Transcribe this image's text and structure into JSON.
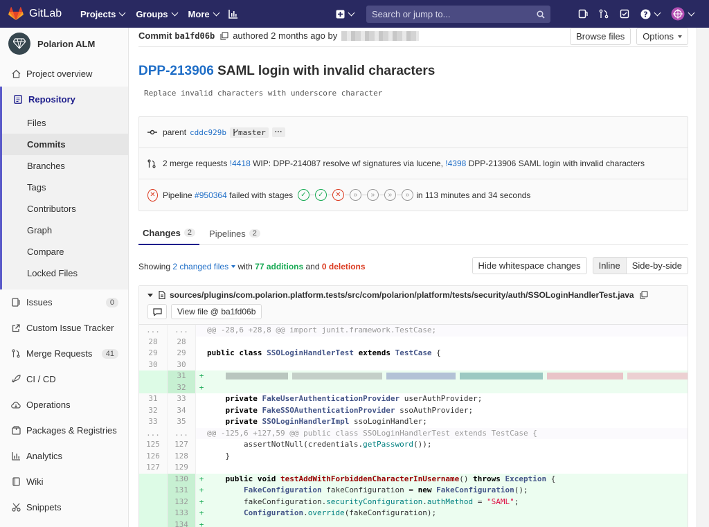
{
  "topbar": {
    "brand": "GitLab",
    "nav": [
      "Projects",
      "Groups",
      "More"
    ],
    "search_placeholder": "Search or jump to...",
    "colors": {
      "bg": "#292961",
      "search_bg": "#4b4b82"
    }
  },
  "sidebar": {
    "project_name": "Polarion ALM",
    "items": [
      {
        "label": "Project overview",
        "icon": "home-icon"
      },
      {
        "label": "Repository",
        "icon": "document-icon"
      },
      {
        "label": "Issues",
        "icon": "issues-icon",
        "badge": "0"
      },
      {
        "label": "Custom Issue Tracker",
        "icon": "external-link-icon"
      },
      {
        "label": "Merge Requests",
        "icon": "merge-request-icon",
        "badge": "41"
      },
      {
        "label": "CI / CD",
        "icon": "rocket-icon"
      },
      {
        "label": "Operations",
        "icon": "cloud-icon"
      },
      {
        "label": "Packages & Registries",
        "icon": "package-icon"
      },
      {
        "label": "Analytics",
        "icon": "chart-icon"
      },
      {
        "label": "Wiki",
        "icon": "book-icon"
      },
      {
        "label": "Snippets",
        "icon": "scissors-icon"
      }
    ],
    "repo_sub": [
      "Files",
      "Commits",
      "Branches",
      "Tags",
      "Contributors",
      "Graph",
      "Compare",
      "Locked Files"
    ]
  },
  "commit": {
    "label": "Commit",
    "sha": "ba1fd06b",
    "authored": "authored 2 months ago by",
    "browse_files": "Browse files",
    "options": "Options",
    "title_ref": "DPP-213906",
    "title_text": "SAML login with invalid characters",
    "description": "Replace invalid characters with underscore character",
    "parent_label": "parent",
    "parent_sha": "cddc929b",
    "branch": "master",
    "more": "···",
    "mr_count_text": "2 merge requests",
    "mr1_ref": "!4418",
    "mr1_text": "WIP: DPP-214087 resolve wf signatures via lucene,",
    "mr2_ref": "!4398",
    "mr2_text": "DPP-213906 SAML login with invalid characters",
    "pipeline_label": "Pipeline",
    "pipeline_ref": "#950364",
    "pipeline_status": "failed with stages",
    "pipeline_duration": "in 113 minutes and 34 seconds",
    "stages": [
      "success",
      "success",
      "failed",
      "skipped",
      "skipped",
      "skipped",
      "skipped"
    ]
  },
  "tabs": [
    {
      "label": "Changes",
      "count": "2"
    },
    {
      "label": "Pipelines",
      "count": "2"
    }
  ],
  "stats": {
    "showing": "Showing",
    "changed": "2 changed files",
    "with": "with",
    "additions": "77 additions",
    "and": "and",
    "deletions": "0 deletions",
    "hide_ws": "Hide whitespace changes",
    "inline": "Inline",
    "side_by_side": "Side-by-side"
  },
  "file": {
    "path": "sources/plugins/com.polarion.platform.tests/src/com/polarion/platform/tests/security/auth/SSOLoginHandlerTest.java",
    "view_file": "View file @ ba1fd06b"
  },
  "diff": [
    {
      "t": "hunk",
      "o": "...",
      "n": "...",
      "c": "@@ -28,6 +28,8 @@ import junit.framework.TestCase;"
    },
    {
      "t": "ctx",
      "o": "28",
      "n": "28",
      "c": ""
    },
    {
      "t": "ctx",
      "o": "29",
      "n": "29",
      "c": "public class SSOLoginHandlerTest extends TestCase {"
    },
    {
      "t": "ctx",
      "o": "30",
      "n": "30",
      "c": ""
    },
    {
      "t": "add",
      "o": "",
      "n": "31",
      "c": "",
      "blur": true
    },
    {
      "t": "add",
      "o": "",
      "n": "32",
      "c": ""
    },
    {
      "t": "ctx",
      "o": "31",
      "n": "33",
      "c": "    private FakeUserAuthenticationProvider userAuthProvider;"
    },
    {
      "t": "ctx",
      "o": "32",
      "n": "34",
      "c": "    private FakeSSOAuthenticationProvider ssoAuthProvider;"
    },
    {
      "t": "ctx",
      "o": "33",
      "n": "35",
      "c": "    private SSOLoginHandlerImpl ssoLoginHandler;"
    },
    {
      "t": "hunk",
      "o": "...",
      "n": "...",
      "c": "@@ -125,6 +127,59 @@ public class SSOLoginHandlerTest extends TestCase {"
    },
    {
      "t": "ctx",
      "o": "125",
      "n": "127",
      "c": "        assertNotNull(credentials.getPassword());"
    },
    {
      "t": "ctx",
      "o": "126",
      "n": "128",
      "c": "    }"
    },
    {
      "t": "ctx",
      "o": "127",
      "n": "129",
      "c": ""
    },
    {
      "t": "add",
      "o": "",
      "n": "130",
      "c": "    public void testAddWithForbiddenCharacterInUsername() throws Exception {"
    },
    {
      "t": "add",
      "o": "",
      "n": "131",
      "c": "        FakeConfiguration fakeConfiguration = new FakeConfiguration();"
    },
    {
      "t": "add",
      "o": "",
      "n": "132",
      "c": "        fakeConfiguration.securityConfiguration.authMethod = \"SAML\";"
    },
    {
      "t": "add",
      "o": "",
      "n": "133",
      "c": "        Configuration.override(fakeConfiguration);"
    },
    {
      "t": "add",
      "o": "",
      "n": "134",
      "c": ""
    }
  ]
}
